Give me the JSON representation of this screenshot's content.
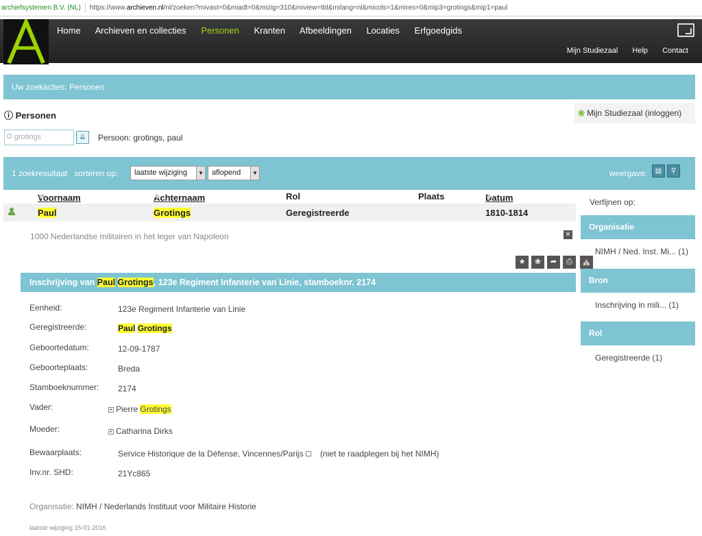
{
  "browser": {
    "site": "archiefsystemen B.V. (NL)",
    "url_prefix": "https://www.",
    "url_domain": "archieven.nl",
    "url_rest": "/nl/zoeken?mivast=0&miadt=0&mizig=310&miview=tbl&milang=nl&micols=1&mires=0&mip3=grotings&mip1=paul"
  },
  "nav": {
    "logo_letter": "A",
    "items": [
      "Home",
      "Archieven en collecties",
      "Personen",
      "Kranten",
      "Afbeeldingen",
      "Locaties",
      "Erfgoedgids"
    ],
    "active": "Personen",
    "sub_items": [
      "Mijn Studiezaal",
      "Help",
      "Contact"
    ]
  },
  "search_actions": "Uw zoekacties: Personen",
  "section": {
    "title": "Personen",
    "mijn_studiezaal": "Mijn Studiezaal (inloggen)"
  },
  "search": {
    "value": "grotings",
    "term": "Persoon: grotings, paul"
  },
  "results_bar": {
    "count": "1 zoekresultaat",
    "sort_label": "sorteren op:",
    "sort_field": "laatste wijziging",
    "sort_order": "aflopend",
    "view_label": "weergave:"
  },
  "table": {
    "headers": [
      "Voornaam",
      "Achternaam",
      "Rol",
      "Plaats",
      "Datum"
    ],
    "row": {
      "voornaam": "Paul",
      "achternaam": "Grotings",
      "rol": "Geregistreerde",
      "plaats": "",
      "datum": "1810-1814"
    }
  },
  "detail": {
    "description": "1000 Nederlandse militairen in het leger van Napoleon",
    "title_prefix": "Inschrijving van",
    "title_first": "Paul",
    "title_last": "Grotings",
    "title_suffix": ", 123e Regiment Infanterie van Linie, stamboeknr. 2174",
    "fields": {
      "eenheid_label": "Eenheid:",
      "eenheid": "123e Regiment Infanterie van Linie",
      "geregistreerde_label": "Geregistreerde:",
      "geregistreerde_first": "Paul",
      "geregistreerde_last": "Grotings",
      "geboortedatum_label": "Geboortedatum:",
      "geboortedatum": "12-09-1787",
      "geboorteplaats_label": "Geboorteplaats:",
      "geboorteplaats": "Breda",
      "stamboeknummer_label": "Stamboeknummer:",
      "stamboeknummer": "2174",
      "vader_label": "Vader:",
      "vader_first": "Pierre",
      "vader_last": "Grotings",
      "moeder_label": "Moeder:",
      "moeder": "Catharina Dirks",
      "bewaarplaats_label": "Bewaarplaats:",
      "bewaarplaats": "Service Historique de la Défense, Vincennes/Parijs",
      "bewaarplaats_note": "(niet te raadplegen bij het NIMH)",
      "invnr_label": "Inv.nr. SHD:",
      "invnr": "21Yc865"
    },
    "organisatie_label": "Organisatie:",
    "organisatie": "NIMH / Nederlands Instituut voor Militaire Historie",
    "last_modified": "laatste wijziging 15-01-2016"
  },
  "refine": {
    "label": "Verfijnen op:",
    "groups": [
      {
        "title": "Organisatie",
        "item": "NIMH / Ned. Inst. Mi... (1)"
      },
      {
        "title": "Bron",
        "item": "Inschrijving in mili... (1)"
      },
      {
        "title": "Rol",
        "item": "Geregistreerde (1)"
      }
    ]
  },
  "colors": {
    "teal": "#7ec4d2",
    "highlight": "#ffff33",
    "active_nav": "#a6d71a",
    "logo": "#9bd400"
  }
}
